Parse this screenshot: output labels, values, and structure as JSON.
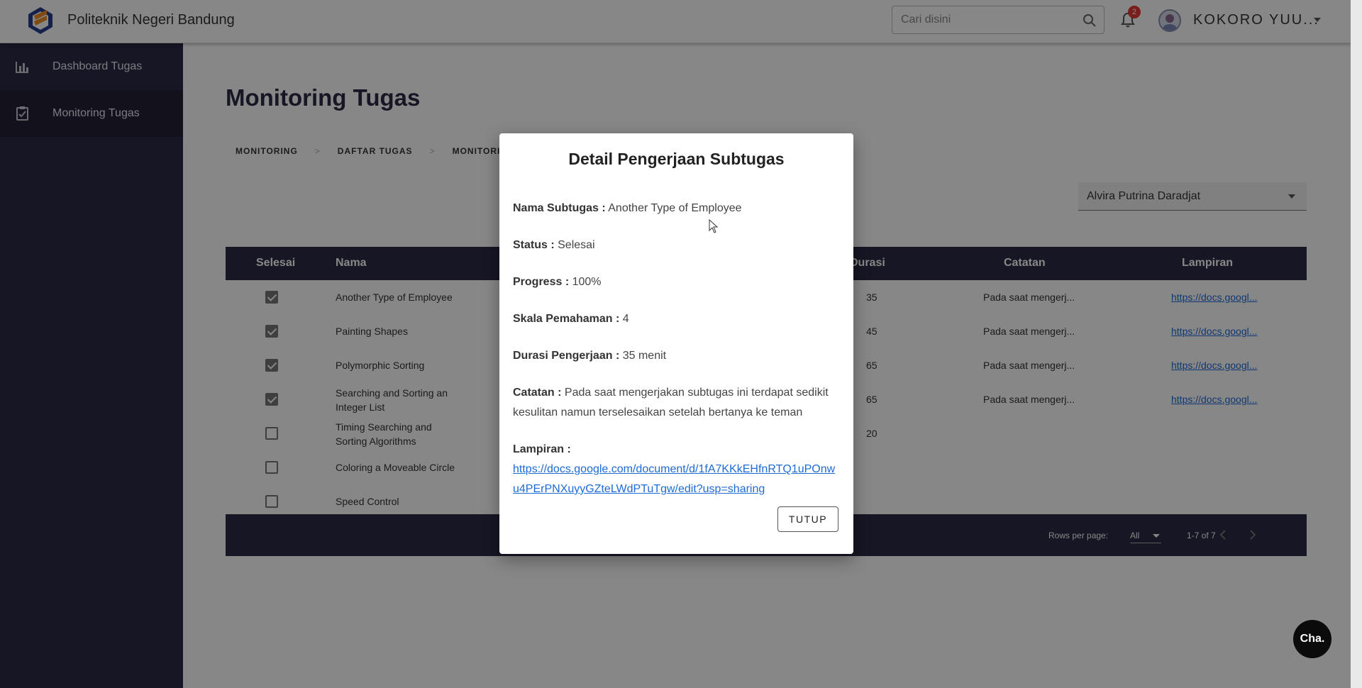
{
  "header": {
    "app_title": "Politeknik Negeri Bandung",
    "search_placeholder": "Cari disini",
    "notification_count": "2",
    "user_name": "KOKORO YUU..."
  },
  "sidebar": {
    "items": [
      {
        "label": "Dashboard Tugas",
        "icon": "bar-chart-icon"
      },
      {
        "label": "Monitoring Tugas",
        "icon": "clipboard-check-icon",
        "active": true
      }
    ]
  },
  "main": {
    "page_title": "Monitoring Tugas",
    "breadcrumb": [
      "MONITORING",
      "DAFTAR TUGAS",
      "MONITORIN"
    ],
    "breadcrumb_sep": ">",
    "selected_user": "Alvira Putrina Daradjat",
    "table": {
      "headers": {
        "selesai": "Selesai",
        "nama": "Nama",
        "durasi": "Durasi",
        "catatan": "Catatan",
        "lampiran": "Lampiran"
      },
      "rows": [
        {
          "done": true,
          "nama": "Another Type of Employee",
          "durasi": "35",
          "catatan": "Pada saat mengerj...",
          "lampiran": "https://docs.googl..."
        },
        {
          "done": true,
          "nama": "Painting Shapes",
          "durasi": "45",
          "catatan": "Pada saat mengerj...",
          "lampiran": "https://docs.googl..."
        },
        {
          "done": true,
          "nama": "Polymorphic Sorting",
          "durasi": "65",
          "catatan": "Pada saat mengerj...",
          "lampiran": "https://docs.googl..."
        },
        {
          "done": true,
          "nama": "Searching and Sorting an Integer List",
          "durasi": "65",
          "catatan": "Pada saat mengerj...",
          "lampiran": "https://docs.googl..."
        },
        {
          "done": false,
          "nama": "Timing Searching and Sorting Algorithms",
          "durasi": "20",
          "catatan": "",
          "lampiran": ""
        },
        {
          "done": false,
          "nama": "Coloring a Moveable Circle",
          "durasi": "",
          "catatan": "",
          "lampiran": ""
        },
        {
          "done": false,
          "nama": "Speed Control",
          "durasi": "",
          "catatan": "",
          "lampiran": ""
        }
      ],
      "footer": {
        "rows_per_page_label": "Rows per page:",
        "rows_per_page_value": "All",
        "range": "1-7 of 7"
      }
    }
  },
  "modal": {
    "title": "Detail Pengerjaan Subtugas",
    "fields": {
      "nama_label": "Nama Subtugas :",
      "nama_value": "Another Type of Employee",
      "status_label": "Status :",
      "status_value": "Selesai",
      "progress_label": "Progress :",
      "progress_value": "100%",
      "skala_label": "Skala Pemahaman :",
      "skala_value": "4",
      "durasi_label": "Durasi Pengerjaan :",
      "durasi_value": "35 menit",
      "catatan_label": "Catatan :",
      "catatan_value": "Pada saat mengerjakan subtugas ini terdapat sedikit kesulitan namun terselesaikan setelah bertanya ke teman",
      "lampiran_label": "Lampiran :",
      "lampiran_value": "https://docs.google.com/document/d/1fA7KKkEHfnRTQ1uPOnwu4PErPNXuyyGZteLWdPTuTgw/edit?usp=sharing"
    },
    "close_label": "TUTUP"
  },
  "chat_label": "Cha.",
  "colors": {
    "sidebar_bg": "#2b2a45",
    "table_header_bg": "#2b2a45",
    "link": "#1e6bd6",
    "badge": "#e53935"
  }
}
